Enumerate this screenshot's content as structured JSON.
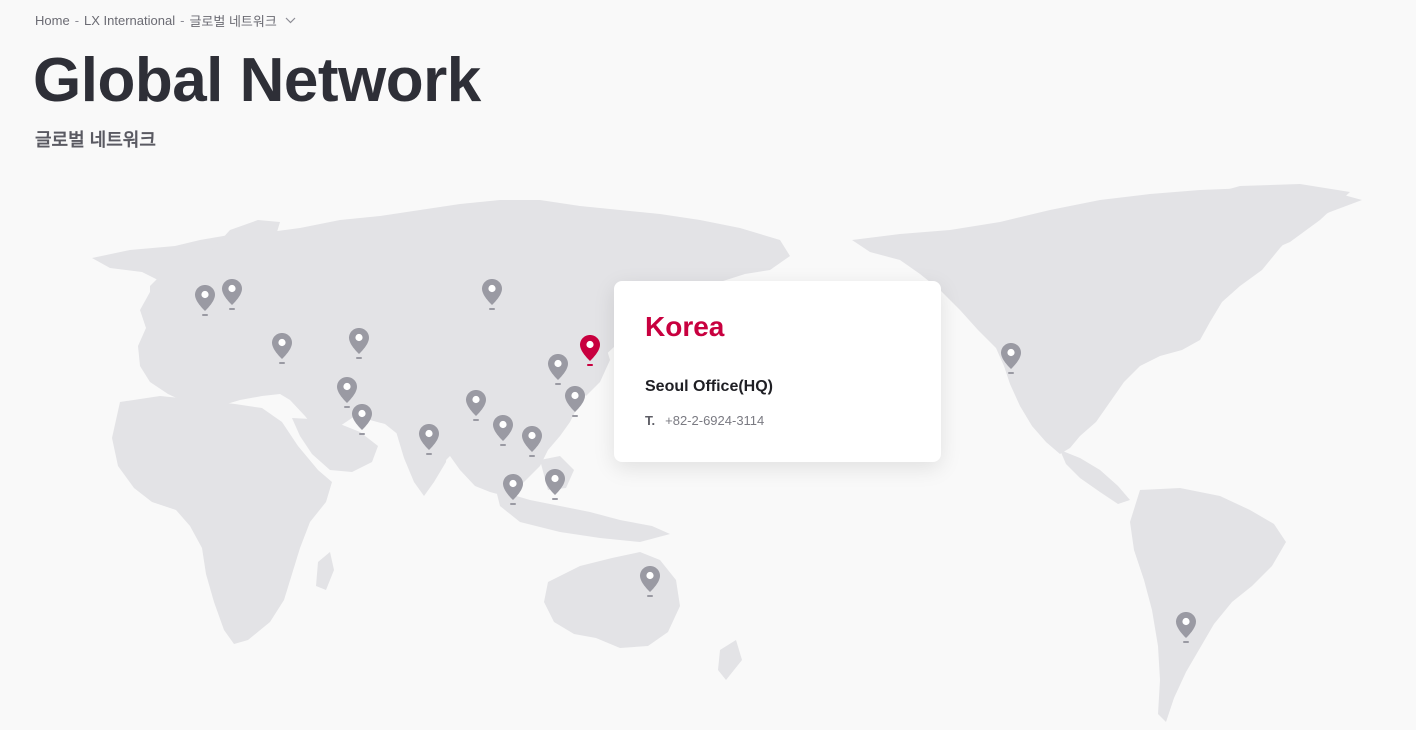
{
  "breadcrumb": {
    "items": [
      "Home",
      "LX International",
      "글로벌 네트워크"
    ],
    "separator": "-"
  },
  "page": {
    "title": "Global Network",
    "subtitle": "글로벌 네트워크"
  },
  "map": {
    "land_color": "#e3e3e6",
    "pin_color": "#9a9aa3",
    "active_pin_color": "#c8003f",
    "pins": [
      {
        "id": "pin-europe-west",
        "active": false
      },
      {
        "id": "pin-europe-north",
        "active": false
      },
      {
        "id": "pin-turkey",
        "active": false
      },
      {
        "id": "pin-central-asia",
        "active": false
      },
      {
        "id": "pin-middle-east-1",
        "active": false
      },
      {
        "id": "pin-middle-east-2",
        "active": false
      },
      {
        "id": "pin-russia",
        "active": false
      },
      {
        "id": "pin-india",
        "active": false
      },
      {
        "id": "pin-myanmar",
        "active": false
      },
      {
        "id": "pin-vietnam-1",
        "active": false
      },
      {
        "id": "pin-vietnam-2",
        "active": false
      },
      {
        "id": "pin-china-north",
        "active": false
      },
      {
        "id": "pin-korea",
        "active": true
      },
      {
        "id": "pin-china-south",
        "active": false
      },
      {
        "id": "pin-malaysia",
        "active": false
      },
      {
        "id": "pin-indonesia",
        "active": false
      },
      {
        "id": "pin-australia",
        "active": false
      },
      {
        "id": "pin-usa",
        "active": false
      },
      {
        "id": "pin-south-america",
        "active": false
      }
    ]
  },
  "info_card": {
    "country": "Korea",
    "office": "Seoul Office(HQ)",
    "phone_label": "T.",
    "phone": "+82-2-6924-3114"
  }
}
